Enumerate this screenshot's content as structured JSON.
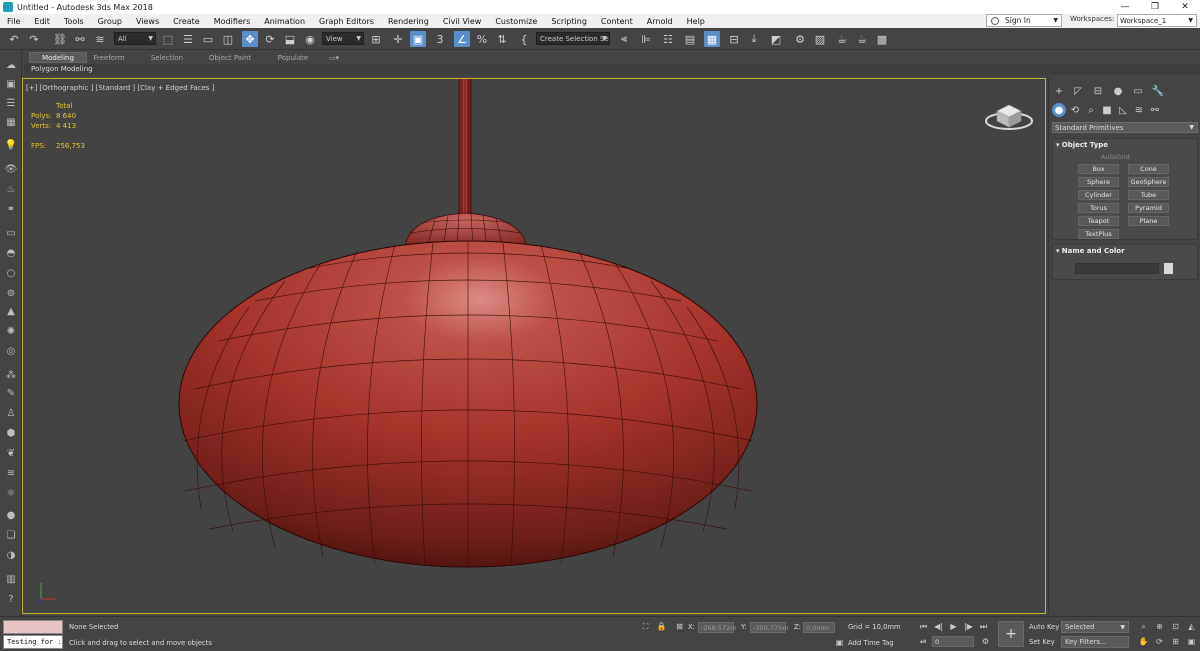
{
  "window": {
    "title": "Untitled - Autodesk 3ds Max 2018",
    "minimize": "—",
    "maximize": "❐",
    "close": "✕"
  },
  "menu": [
    "File",
    "Edit",
    "Tools",
    "Group",
    "Views",
    "Create",
    "Modifiers",
    "Animation",
    "Graph Editors",
    "Rendering",
    "Civil View",
    "Customize",
    "Scripting",
    "Content",
    "Arnold",
    "Help"
  ],
  "account": {
    "sign_in": "Sign In",
    "workspaces_label": "Workspaces:",
    "workspace_value": "Workspace_1"
  },
  "toolbar": {
    "selection_filter": "All",
    "reference_coord": "View",
    "named_selection": "Create Selection Se"
  },
  "ribbon": {
    "tabs": [
      "Modeling",
      "Freeform",
      "Selection",
      "Object Paint",
      "Populate"
    ],
    "active_tab": "Modeling",
    "sub_label": "Polygon Modeling"
  },
  "viewport": {
    "label": "[+] [Orthographic ] [Standard ] [Clay + Edged Faces ]",
    "stats": {
      "total_label": "Total",
      "polys_label": "Polys:",
      "polys_value": "8 640",
      "verts_label": "Verts:",
      "verts_value": "4 413",
      "fps_label": "FPS:",
      "fps_value": "256,753"
    },
    "colors": {
      "object": "#a5332a",
      "border": "#c9b52d",
      "background": "#434343"
    }
  },
  "command_panel": {
    "category": "Standard Primitives",
    "object_type_title": "Object Type",
    "autogrid": "AutoGrid",
    "buttons": [
      "Box",
      "Cone",
      "Sphere",
      "GeoSphere",
      "Cylinder",
      "Tube",
      "Torus",
      "Pyramid",
      "Teapot",
      "Plane",
      "TextPlus"
    ],
    "name_color_title": "Name and Color"
  },
  "status": {
    "listener_text": "Testing for :",
    "selection_status": "None Selected",
    "prompt": "Click and drag to select and move objects",
    "x_label": "X:",
    "x_value": "-268,572m",
    "y_label": "Y:",
    "y_value": "-350,775m",
    "z_label": "Z:",
    "z_value": "0,0mm",
    "grid": "Grid = 10,0mm",
    "add_time_tag": "Add Time Tag",
    "frame": "0",
    "auto_key": "Auto Key",
    "set_key": "Set Key",
    "key_mode": "Selected",
    "key_filters": "Key Filters..."
  }
}
